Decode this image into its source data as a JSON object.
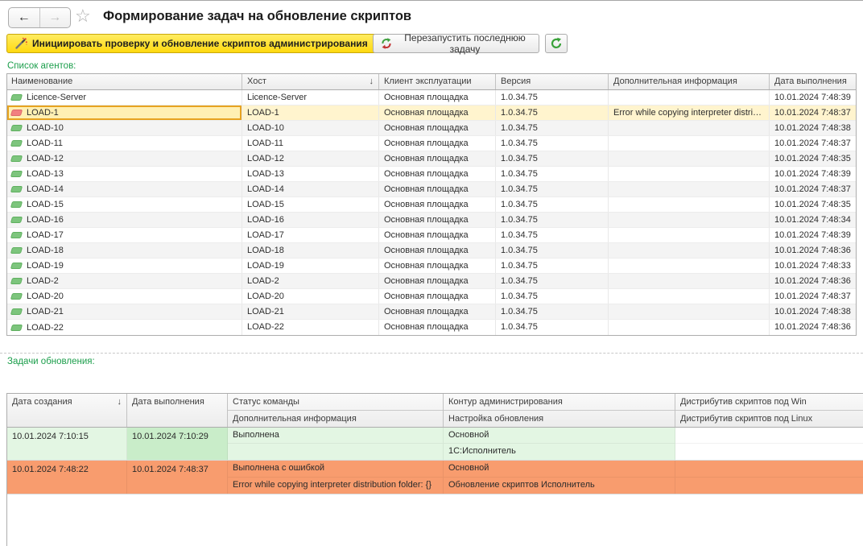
{
  "nav": {
    "title": "Формирование задач на обновление скриптов",
    "back_icon": "←",
    "forward_icon": "→",
    "favorite_icon": "☆"
  },
  "toolbar": {
    "init_button": "Инициировать проверку и обновление скриптов администрирования",
    "restart_button": "Перезапустить последнюю задачу"
  },
  "agents": {
    "label": "Список агентов:",
    "columns": [
      "Наименование",
      "Хост",
      "Клиент эксплуатации",
      "Версия",
      "Дополнительная информация",
      "Дата выполнения"
    ],
    "sort_column": "Хост",
    "sort_icon": "↓",
    "rows": [
      {
        "name": "Licence-Server",
        "host": "Licence-Server",
        "client": "Основная площадка",
        "version": "1.0.34.75",
        "info": "",
        "date": "10.01.2024 7:48:39",
        "status": "ok"
      },
      {
        "name": "LOAD-1",
        "host": "LOAD-1",
        "client": "Основная площадка",
        "version": "1.0.34.75",
        "info": "Error while copying interpreter distribution folder: {}",
        "date": "10.01.2024 7:48:37",
        "status": "error",
        "selected": true
      },
      {
        "name": "LOAD-10",
        "host": "LOAD-10",
        "client": "Основная площадка",
        "version": "1.0.34.75",
        "info": "",
        "date": "10.01.2024 7:48:38",
        "status": "ok"
      },
      {
        "name": "LOAD-11",
        "host": "LOAD-11",
        "client": "Основная площадка",
        "version": "1.0.34.75",
        "info": "",
        "date": "10.01.2024 7:48:37",
        "status": "ok"
      },
      {
        "name": "LOAD-12",
        "host": "LOAD-12",
        "client": "Основная площадка",
        "version": "1.0.34.75",
        "info": "",
        "date": "10.01.2024 7:48:35",
        "status": "ok"
      },
      {
        "name": "LOAD-13",
        "host": "LOAD-13",
        "client": "Основная площадка",
        "version": "1.0.34.75",
        "info": "",
        "date": "10.01.2024 7:48:39",
        "status": "ok"
      },
      {
        "name": "LOAD-14",
        "host": "LOAD-14",
        "client": "Основная площадка",
        "version": "1.0.34.75",
        "info": "",
        "date": "10.01.2024 7:48:37",
        "status": "ok"
      },
      {
        "name": "LOAD-15",
        "host": "LOAD-15",
        "client": "Основная площадка",
        "version": "1.0.34.75",
        "info": "",
        "date": "10.01.2024 7:48:35",
        "status": "ok"
      },
      {
        "name": "LOAD-16",
        "host": "LOAD-16",
        "client": "Основная площадка",
        "version": "1.0.34.75",
        "info": "",
        "date": "10.01.2024 7:48:34",
        "status": "ok"
      },
      {
        "name": "LOAD-17",
        "host": "LOAD-17",
        "client": "Основная площадка",
        "version": "1.0.34.75",
        "info": "",
        "date": "10.01.2024 7:48:39",
        "status": "ok"
      },
      {
        "name": "LOAD-18",
        "host": "LOAD-18",
        "client": "Основная площадка",
        "version": "1.0.34.75",
        "info": "",
        "date": "10.01.2024 7:48:36",
        "status": "ok"
      },
      {
        "name": "LOAD-19",
        "host": "LOAD-19",
        "client": "Основная площадка",
        "version": "1.0.34.75",
        "info": "",
        "date": "10.01.2024 7:48:33",
        "status": "ok"
      },
      {
        "name": "LOAD-2",
        "host": "LOAD-2",
        "client": "Основная площадка",
        "version": "1.0.34.75",
        "info": "",
        "date": "10.01.2024 7:48:36",
        "status": "ok"
      },
      {
        "name": "LOAD-20",
        "host": "LOAD-20",
        "client": "Основная площадка",
        "version": "1.0.34.75",
        "info": "",
        "date": "10.01.2024 7:48:37",
        "status": "ok"
      },
      {
        "name": "LOAD-21",
        "host": "LOAD-21",
        "client": "Основная площадка",
        "version": "1.0.34.75",
        "info": "",
        "date": "10.01.2024 7:48:38",
        "status": "ok"
      },
      {
        "name": "LOAD-22",
        "host": "LOAD-22",
        "client": "Основная площадка",
        "version": "1.0.34.75",
        "info": "",
        "date": "10.01.2024 7:48:36",
        "status": "ok"
      }
    ]
  },
  "tasks": {
    "label": "Задачи обновления:",
    "columns": {
      "created": "Дата создания",
      "executed": "Дата выполнения",
      "status": "Статус команды",
      "info": "Дополнительная информация",
      "contour": "Контур администрирования",
      "setting": "Настройка обновления",
      "win": "Дистрибутив скриптов под Win",
      "linux": "Дистрибутив скриптов под Linux"
    },
    "sort_column": "Дата создания",
    "sort_icon": "↓",
    "rows": [
      {
        "created": "10.01.2024 7:10:15",
        "executed": "10.01.2024 7:10:29",
        "status": "Выполнена",
        "info": "",
        "contour": "Основной",
        "setting": "1С:Исполнитель",
        "win": "",
        "linux": "",
        "state": "success"
      },
      {
        "created": "10.01.2024 7:48:22",
        "executed": "10.01.2024 7:48:37",
        "status": "Выполнена с ошибкой",
        "info": "Error while copying interpreter distribution folder: {}",
        "contour": "Основной",
        "setting": "Обновление скриптов Исполнитель",
        "win": "",
        "linux": "",
        "state": "error"
      }
    ]
  },
  "colors": {
    "accent_yellow": "#FFD910",
    "selected_row": "#FFF4CE",
    "focus_border": "#E7A320",
    "success_row": "#E3F6E3",
    "error_row": "#F89C6E",
    "section_label_green": "#1B9E4B"
  }
}
